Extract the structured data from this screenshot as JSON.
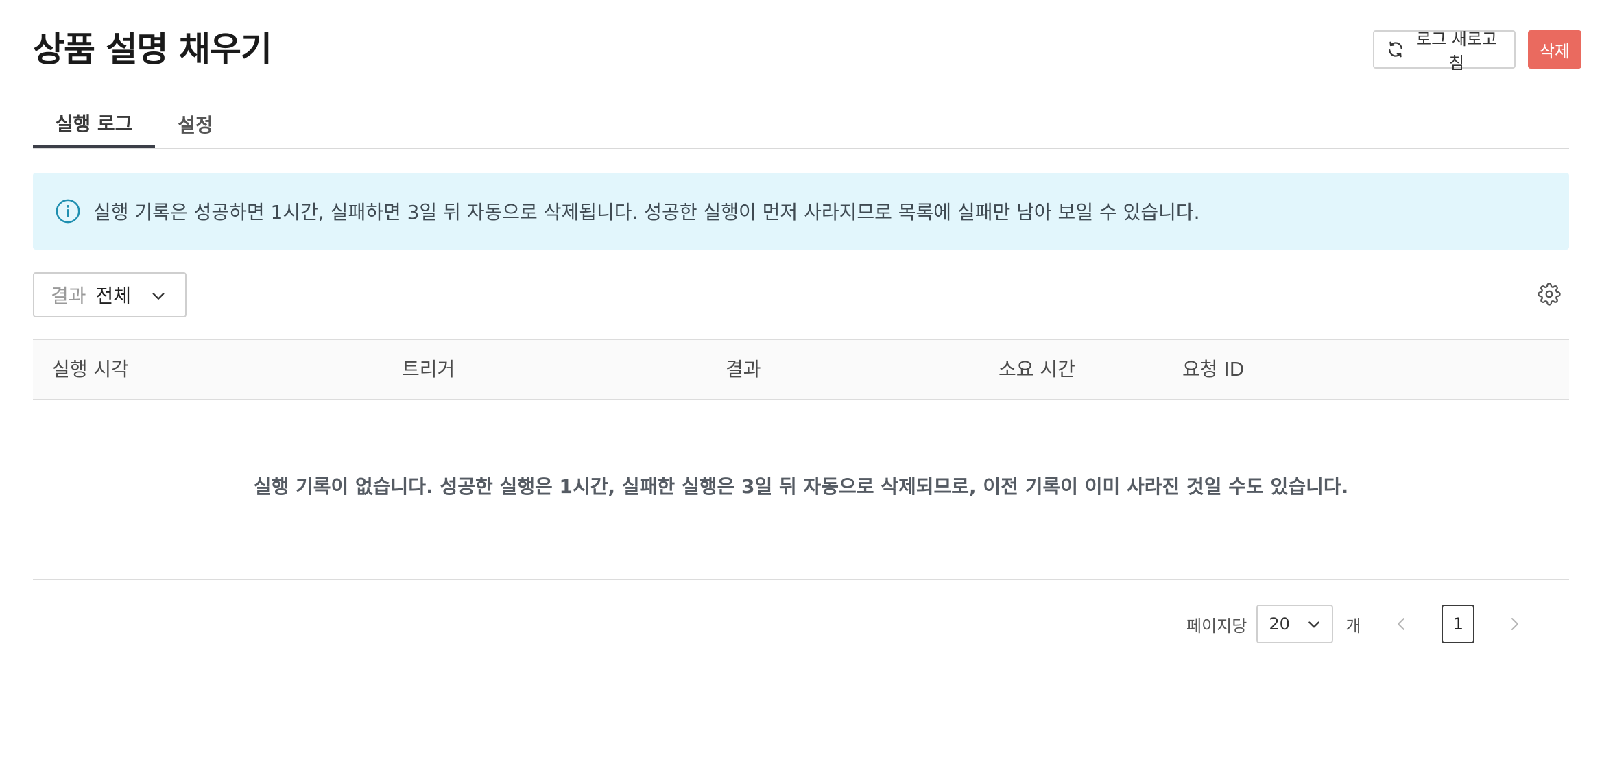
{
  "header": {
    "title": "상품 설명 채우기",
    "refresh_label": "로그 새로고침",
    "delete_label": "삭제"
  },
  "tabs": [
    {
      "label": "실행 로그",
      "active": true
    },
    {
      "label": "설정",
      "active": false
    }
  ],
  "info_banner": {
    "text": "실행 기록은 성공하면 1시간, 실패하면 3일 뒤 자동으로 삭제됩니다. 성공한 실행이 먼저 사라지므로 목록에 실패만 남아 보일 수 있습니다."
  },
  "filter": {
    "label": "결과",
    "value": "전체"
  },
  "table": {
    "columns": [
      "실행 시각",
      "트리거",
      "결과",
      "소요 시간",
      "요청 ID"
    ],
    "rows": [],
    "empty_message": "실행 기록이 없습니다. 성공한 실행은 1시간, 실패한 실행은 3일 뒤 자동으로 삭제되므로, 이전 기록이 이미 사라진 것일 수도 있습니다."
  },
  "pagination": {
    "per_page_label": "페이지당",
    "per_page_value": "20",
    "unit_label": "개",
    "current_page": "1"
  },
  "colors": {
    "danger": "#ea6a5f",
    "info_background": "#e2f6fc",
    "info_icon": "#1f8fb0",
    "tab_active_underline": "#3c3f48"
  },
  "icons": {
    "refresh": "refresh-icon",
    "info": "info-icon",
    "chevron": "chevron-down-icon",
    "settings": "gear-icon",
    "prev": "chevron-left-icon",
    "next": "chevron-right-icon"
  }
}
